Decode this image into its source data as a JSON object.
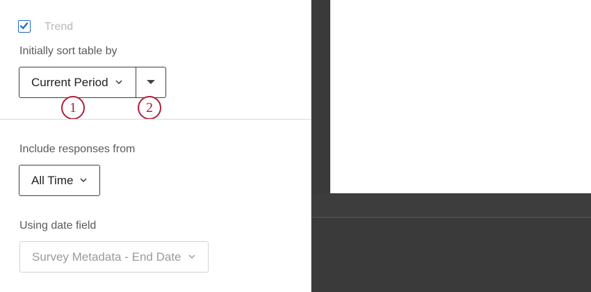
{
  "trend": {
    "label": "Trend",
    "checked": true,
    "check_icon": "checkmark-icon"
  },
  "sort": {
    "label": "Initially sort table by",
    "field_value": "Current Period",
    "field_icon": "chevron-down-icon",
    "order_icon": "caret-down-icon",
    "callouts": [
      "1",
      "2"
    ]
  },
  "responses": {
    "label": "Include responses from",
    "value": "All Time",
    "icon": "chevron-down-icon"
  },
  "date_field": {
    "label": "Using date field",
    "value": "Survey Metadata - End Date",
    "icon": "chevron-down-icon",
    "disabled": true
  },
  "colors": {
    "accent": "#1b66c9",
    "callout": "#b01e3a",
    "canvas_bg": "#3a3a3a"
  }
}
